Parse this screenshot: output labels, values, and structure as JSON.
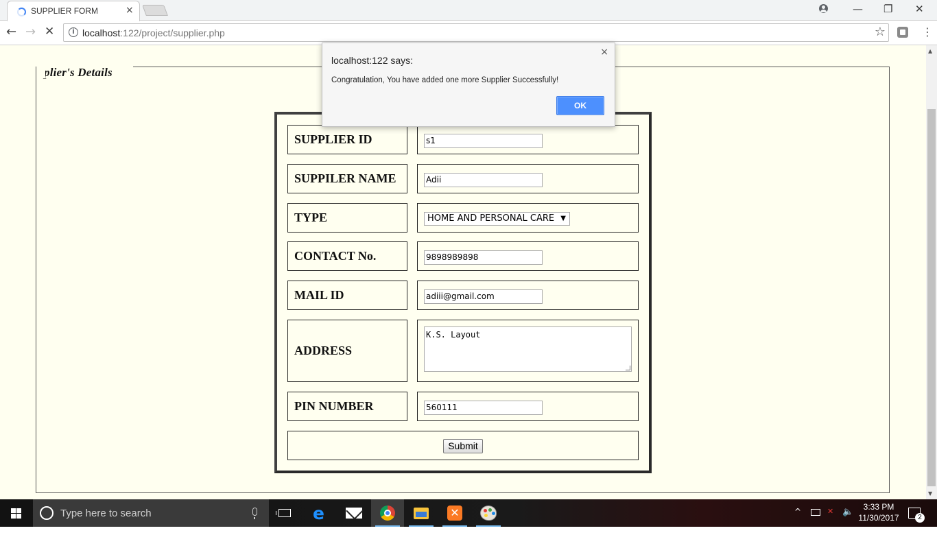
{
  "browser": {
    "tab_title": "SUPPLIER FORM",
    "tab_close": "×",
    "url_host": "localhost",
    "url_path": ":122/project/supplier.php",
    "icons": [
      "back-arrow-icon",
      "forward-arrow-icon",
      "stop-icon",
      "info-icon",
      "star-icon",
      "extension-icon",
      "menu-icon",
      "profile-icon"
    ]
  },
  "page": {
    "background": "#fffff0",
    "legend": "plier's Details"
  },
  "form": {
    "rows": [
      {
        "label": "SUPPLIER ID",
        "value": "s1"
      },
      {
        "label": "SUPPILER NAME",
        "value": "Adii"
      },
      {
        "label": "TYPE",
        "value": "HOME AND PERSONAL CARE"
      },
      {
        "label": "CONTACT No.",
        "value": "9898989898"
      },
      {
        "label": "MAIL ID",
        "value": "adiii@gmail.com"
      },
      {
        "label": "ADDRESS",
        "value": "K.S. Layout"
      },
      {
        "label": "PIN NUMBER",
        "value": "560111"
      }
    ],
    "submit_label": "Submit"
  },
  "alert": {
    "title": "localhost:122 says:",
    "message": "Congratulation, You have added one more Supplier Successfully!",
    "ok_label": "OK",
    "close": "×",
    "ok_color": "#4d90fe"
  },
  "taskbar": {
    "search_placeholder": "Type here to search",
    "time": "3:33 PM",
    "date": "11/30/2017",
    "notification_count": "2",
    "apps": [
      "task-view",
      "edge",
      "mail",
      "chrome",
      "file-explorer",
      "xampp",
      "paint"
    ]
  }
}
